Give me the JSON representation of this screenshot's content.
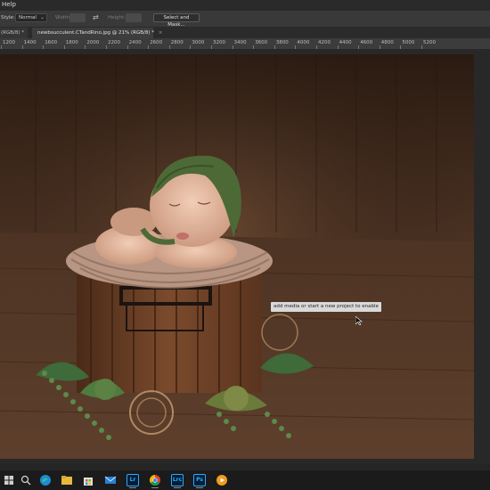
{
  "menubar": {
    "help_label": "Help"
  },
  "options": {
    "style_label": "Style:",
    "style_value": "Normal",
    "width_label": "Width:",
    "height_label": "Height:",
    "select_mask_label": "Select and Mask..."
  },
  "tabs": [
    {
      "label": "(RGB/8) *",
      "close": "×"
    },
    {
      "label": "newbsucculent.CTandRino.jpg @ 21% (RGB/8) *",
      "close": "×"
    }
  ],
  "ruler": {
    "ticks": [
      "1200",
      "1400",
      "1600",
      "1800",
      "2000",
      "2200",
      "2400",
      "2600",
      "2800",
      "3000",
      "3200",
      "3400",
      "3600",
      "3800",
      "4000",
      "4200",
      "4400",
      "4600",
      "4800",
      "5000",
      "5200"
    ]
  },
  "canvas": {
    "tooltip": "add media or start a new project to enable"
  },
  "taskbar": {
    "icons": [
      {
        "name": "windows-start-icon",
        "text": ""
      },
      {
        "name": "search-icon",
        "text": ""
      },
      {
        "name": "task-view-icon",
        "text": ""
      },
      {
        "name": "edge-browser-icon",
        "text": ""
      },
      {
        "name": "file-explorer-icon",
        "text": ""
      },
      {
        "name": "microsoft-store-icon",
        "text": ""
      },
      {
        "name": "mail-icon",
        "text": ""
      },
      {
        "name": "lightroom-icon",
        "text": "Lr"
      },
      {
        "name": "chrome-icon",
        "text": ""
      },
      {
        "name": "lightroom-classic-icon",
        "text": "Lrc"
      },
      {
        "name": "photoshop-icon",
        "text": "Ps"
      },
      {
        "name": "media-player-icon",
        "text": ""
      }
    ]
  },
  "colors": {
    "app_bg": "#282828",
    "panel": "#393939",
    "photoshop_blue": "#31a8ff",
    "lightroom_blue": "#31a8ff"
  }
}
